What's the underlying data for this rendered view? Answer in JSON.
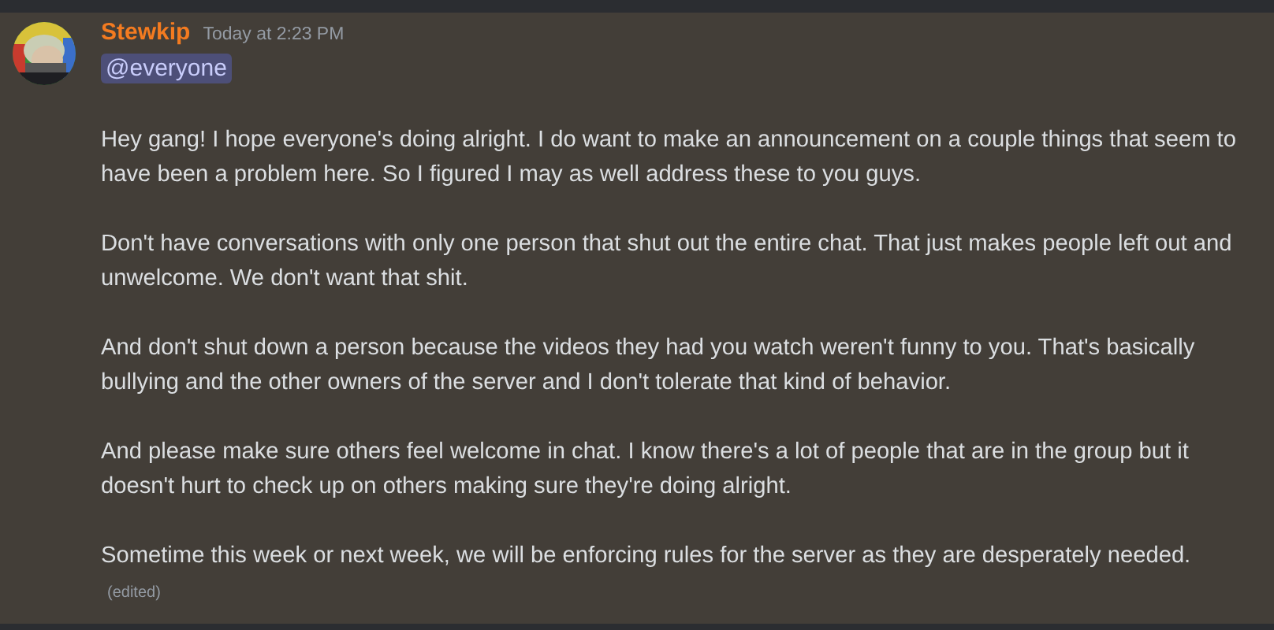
{
  "message": {
    "author": "Stewkip",
    "timestamp": "Today at 2:23 PM",
    "mention": "@everyone",
    "paragraphs": [
      "Hey gang! I hope everyone's doing alright. I do want to make an announcement on a couple things that seem to have been a problem here. So I figured I may as well address these to you guys.",
      "Don't have conversations with only one person that shut out the entire chat. That just makes people left out and unwelcome. We don't want that shit.",
      "And don't shut down a person because the videos they had you watch weren't funny to you. That's basically bullying and the other owners of the server and I don't tolerate that kind of behavior.",
      "And please make sure others feel welcome in chat. I know there's a lot of people that are in the group but it doesn't hurt to check up on others making sure they're doing alright.",
      "Sometime this week or next week, we will be enforcing rules for the server as they are desperately needed."
    ],
    "edited_label": "(edited)"
  }
}
